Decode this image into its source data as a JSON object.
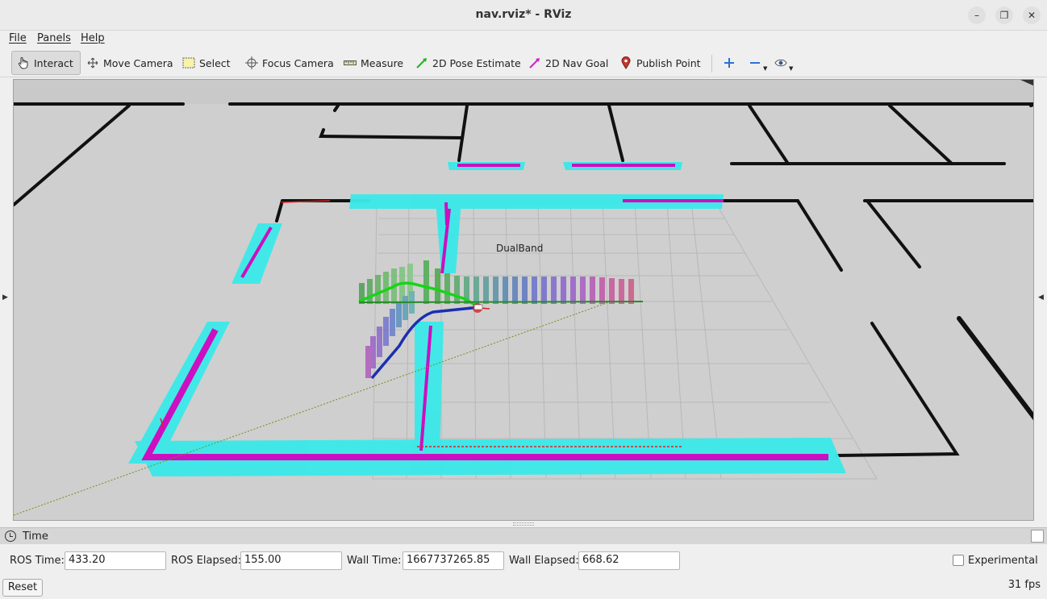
{
  "window": {
    "title": "nav.rviz* - RViz"
  },
  "menu": {
    "file": "File",
    "panels": "Panels",
    "help": "Help"
  },
  "toolbar": {
    "interact": "Interact",
    "move_camera": "Move Camera",
    "select": "Select",
    "focus_camera": "Focus Camera",
    "measure": "Measure",
    "pose_estimate": "2D Pose Estimate",
    "nav_goal": "2D Nav Goal",
    "publish_point": "Publish Point"
  },
  "viewport": {
    "label": "DualBand"
  },
  "time_panel": {
    "title": "Time",
    "ros_time_label": "ROS Time:",
    "ros_time": "433.20",
    "ros_elapsed_label": "ROS Elapsed:",
    "ros_elapsed": "155.00",
    "wall_time_label": "Wall Time:",
    "wall_time": "1667737265.85",
    "wall_elapsed_label": "Wall Elapsed:",
    "wall_elapsed": "668.62",
    "experimental_label": "Experimental"
  },
  "status": {
    "reset": "Reset",
    "fps": "31 fps"
  },
  "colors": {
    "costmap_inflation": "#3de8e8",
    "costmap_lethal": "#cc0fc0",
    "global_path": "#1a2fb0",
    "local_path": "#18d418",
    "map_background": "#c9c9c9"
  }
}
